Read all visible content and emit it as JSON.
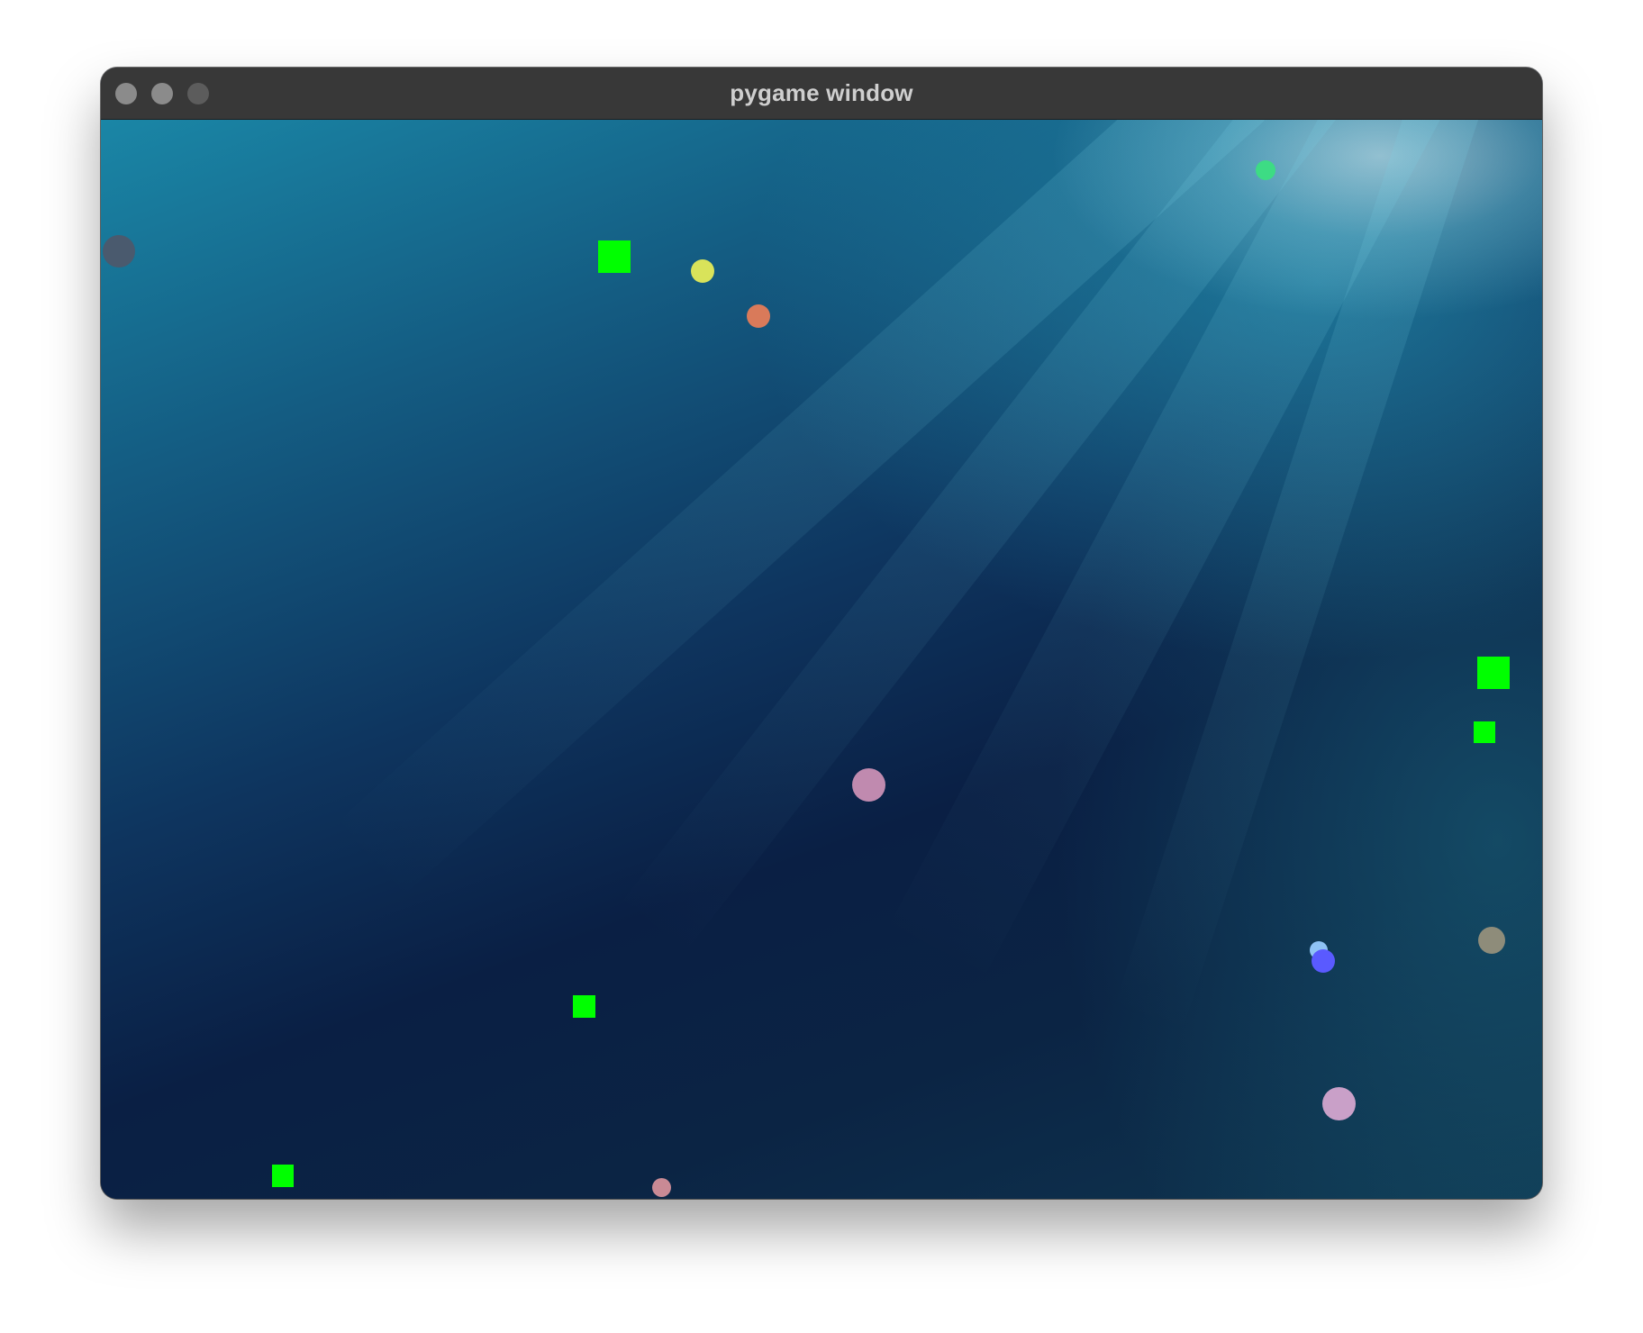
{
  "window": {
    "title": "pygame window"
  },
  "titlebar_buttons": [
    {
      "name": "close",
      "icon": "close-circle-icon"
    },
    {
      "name": "minimize",
      "icon": "minimize-circle-icon"
    },
    {
      "name": "zoom",
      "icon": "zoom-circle-icon"
    }
  ],
  "scene": {
    "background": "underwater-light-rays",
    "colors": {
      "green_square": "#00ff00",
      "grey_blob": "#4a5a6e",
      "yellow_dot": "#d9e35a",
      "orange_dot": "#d97a5a",
      "green_dot": "#3ddc84",
      "mauve_dot": "#c08aaf",
      "light_blue_dot": "#8fc3f5",
      "blue_dot": "#5a5aff",
      "olive_dot": "#8e8c7a",
      "pink_dot": "#c9a0c8",
      "rose_dot": "#c98a95"
    }
  }
}
